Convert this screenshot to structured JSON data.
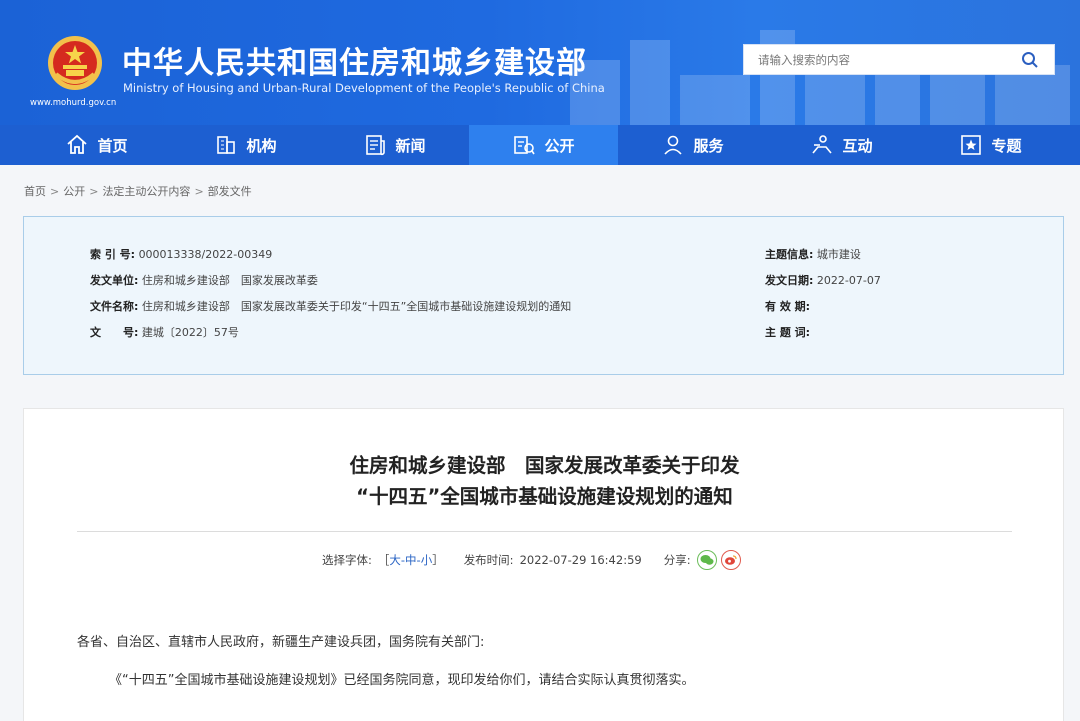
{
  "header": {
    "title": "中华人民共和国住房和城乡建设部",
    "subtitle": "Ministry of Housing and Urban-Rural Development of the People's Republic of China",
    "url": "www.mohurd.gov.cn",
    "search_placeholder": "请输入搜索的内容",
    "search_icon": "search-icon",
    "brand_color": "#1d5fd1",
    "active_nav_color": "#2e80ee"
  },
  "nav": {
    "items": [
      {
        "label": "首页",
        "icon": "home-icon"
      },
      {
        "label": "机构",
        "icon": "building-icon"
      },
      {
        "label": "新闻",
        "icon": "news-icon"
      },
      {
        "label": "公开",
        "icon": "disclosure-icon",
        "active": true
      },
      {
        "label": "服务",
        "icon": "service-icon"
      },
      {
        "label": "互动",
        "icon": "interaction-icon"
      },
      {
        "label": "专题",
        "icon": "topic-icon"
      }
    ]
  },
  "breadcrumb": [
    "首页",
    "公开",
    "法定主动公开内容",
    "部发文件"
  ],
  "info": {
    "index_label": "索 引 号:",
    "index_value": "000013338/2022-00349",
    "issuer_label": "发文单位:",
    "issuer_value": "住房和城乡建设部　国家发展改革委",
    "filename_label": "文件名称:",
    "filename_value": "住房和城乡建设部　国家发展改革委关于印发“十四五”全国城市基础设施建设规划的通知",
    "docno_label": "文　　号:",
    "docno_value": "建城〔2022〕57号",
    "topic_label": "主题信息:",
    "topic_value": "城市建设",
    "date_label": "发文日期:",
    "date_value": "2022-07-07",
    "validity_label": "有 效 期:",
    "validity_value": "",
    "keywords_label": "主 题 词:",
    "keywords_value": ""
  },
  "article": {
    "title_line1": "住房和城乡建设部　国家发展改革委关于印发",
    "title_line2": "“十四五”全国城市基础设施建设规划的通知",
    "font_label": "选择字体:",
    "font_open": "［",
    "font_large": "大",
    "font_medium": "中",
    "font_small": "小",
    "font_close": "］",
    "font_dash": "-",
    "published_label": "发布时间:",
    "published_value": "2022-07-29 16:42:59",
    "share_label": "分享:",
    "share_icons": [
      "wechat-icon",
      "weibo-icon"
    ],
    "paragraph1": "各省、自治区、直辖市人民政府，新疆生产建设兵团，国务院有关部门:",
    "paragraph2": "《“十四五”全国城市基础设施建设规划》已经国务院同意，现印发给你们，请结合实际认真贯彻落实。"
  }
}
